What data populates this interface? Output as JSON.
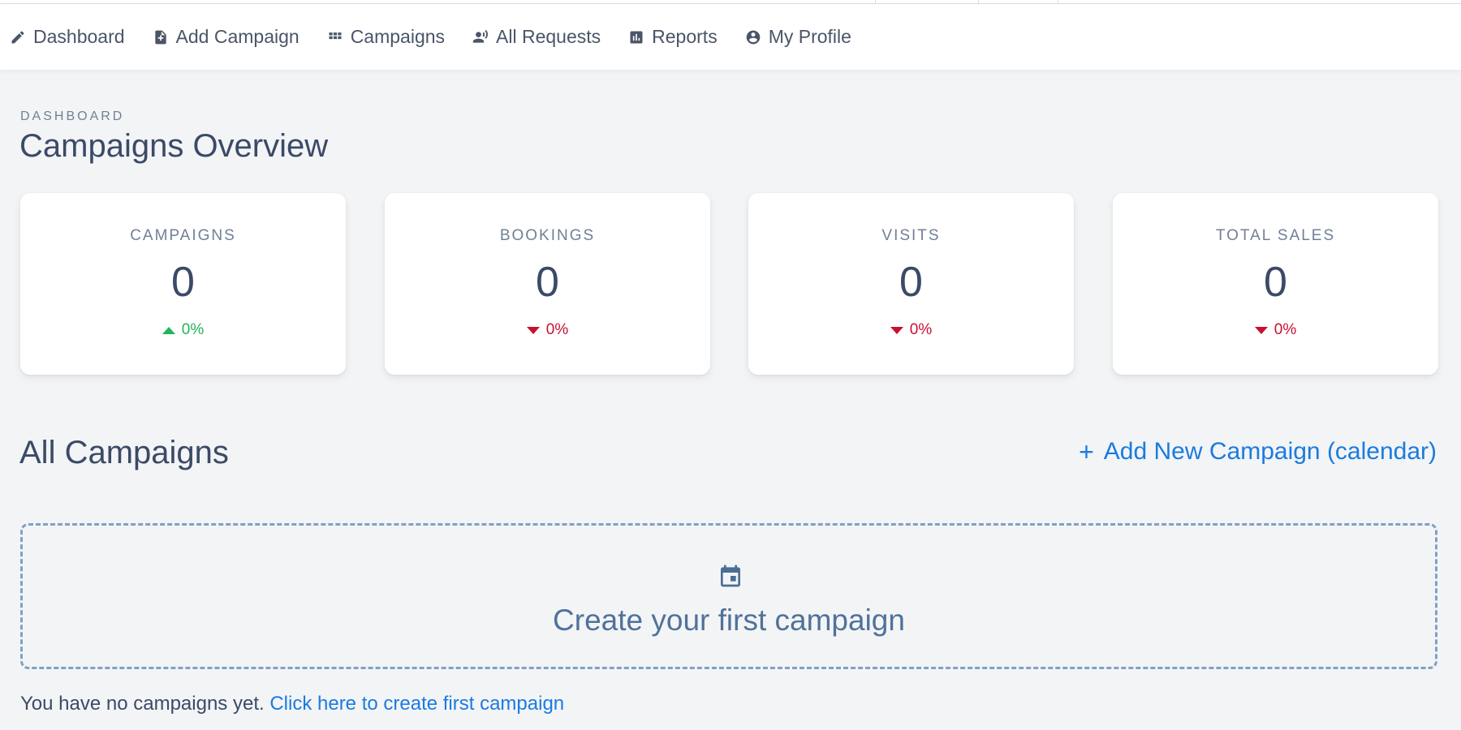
{
  "nav": {
    "items": [
      {
        "label": "Dashboard",
        "icon": "pencil-icon"
      },
      {
        "label": "Add Campaign",
        "icon": "document-plus-icon"
      },
      {
        "label": "Campaigns",
        "icon": "grid-icon"
      },
      {
        "label": "All Requests",
        "icon": "person-voice-icon"
      },
      {
        "label": "Reports",
        "icon": "bar-chart-icon"
      },
      {
        "label": "My Profile",
        "icon": "user-circle-icon"
      }
    ]
  },
  "header": {
    "overline": "DASHBOARD",
    "title": "Campaigns Overview"
  },
  "stats": [
    {
      "label": "CAMPAIGNS",
      "value": "0",
      "change": "0%",
      "direction": "up",
      "color": "#22b45a"
    },
    {
      "label": "BOOKINGS",
      "value": "0",
      "change": "0%",
      "direction": "down",
      "color": "#c8102e"
    },
    {
      "label": "VISITS",
      "value": "0",
      "change": "0%",
      "direction": "down",
      "color": "#c8102e"
    },
    {
      "label": "TOTAL SALES",
      "value": "0",
      "change": "0%",
      "direction": "down",
      "color": "#c8102e"
    }
  ],
  "campaigns": {
    "title": "All Campaigns",
    "add_label": "Add New Campaign (calendar)",
    "add_icon": "plus-icon",
    "empty_icon": "calendar-icon",
    "empty_title": "Create your first campaign",
    "empty_text": "You have no campaigns yet.",
    "empty_link": "Click here to create first campaign"
  },
  "colors": {
    "accent": "#1a7be0",
    "positive": "#22b45a",
    "negative": "#c8102e",
    "text": "#3b4a66"
  }
}
